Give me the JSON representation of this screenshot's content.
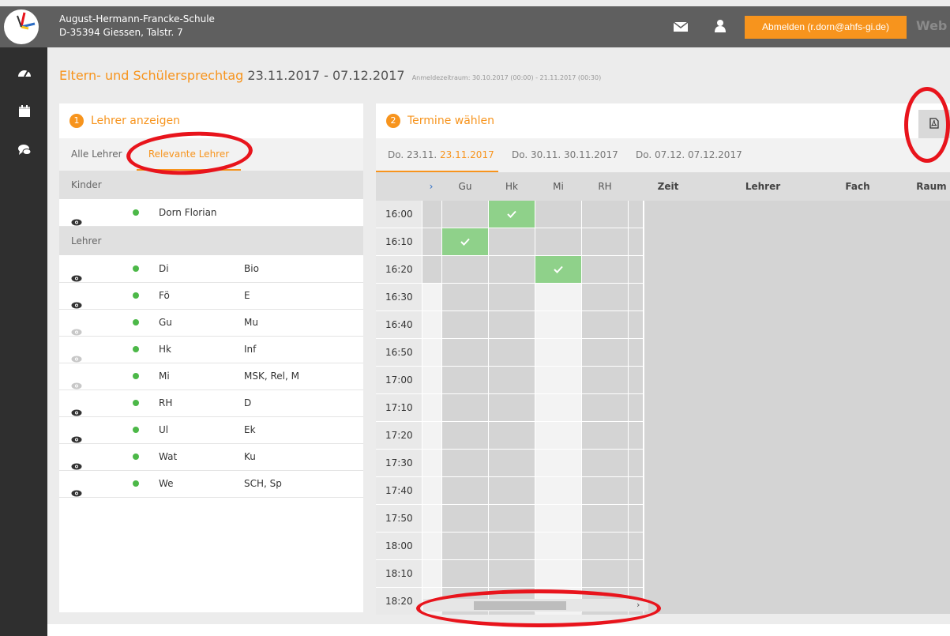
{
  "header": {
    "school_name": "August-Hermann-Francke-Schule",
    "school_address": "D-35394 Giessen, Talstr. 7",
    "logout_label": "Abmelden (r.dorn@ahfs-gi.de)",
    "brand_fragment": "Web",
    "icons": [
      "mail-icon",
      "user-icon"
    ],
    "accent_color": "#f7941d"
  },
  "nav": {
    "icons": [
      "dashboard-icon",
      "calendar-icon",
      "chat-icon"
    ]
  },
  "title": {
    "event": "Eltern- und Schülersprechtag",
    "dates": "23.11.2017 - 07.12.2017",
    "registration": "Anmeldezeitraum: 30.10.2017 (00:00) - 21.11.2017 (00:30)"
  },
  "left_panel": {
    "step": "1",
    "title": "Lehrer anzeigen",
    "tabs": [
      "Alle Lehrer",
      "Relevante Lehrer"
    ],
    "active_tab": "Relevante Lehrer",
    "children_section": "Kinder",
    "children": [
      {
        "name": "Dorn Florian"
      }
    ],
    "teachers_section": "Lehrer",
    "teachers": [
      {
        "name": "Di",
        "subject": "Bio",
        "visible": true
      },
      {
        "name": "Fö",
        "subject": "E",
        "visible": true
      },
      {
        "name": "Gu",
        "subject": "Mu",
        "visible": false
      },
      {
        "name": "Hk",
        "subject": "Inf",
        "visible": false
      },
      {
        "name": "Mi",
        "subject": "MSK, Rel, M",
        "visible": false
      },
      {
        "name": "RH",
        "subject": "D",
        "visible": true
      },
      {
        "name": "Ul",
        "subject": "Ek",
        "visible": true
      },
      {
        "name": "Wat",
        "subject": "Ku",
        "visible": true
      },
      {
        "name": "We",
        "subject": "SCH, Sp",
        "visible": true
      }
    ]
  },
  "right_panel": {
    "step": "2",
    "title": "Termine wählen",
    "pdf_icon": "pdf-icon",
    "date_tabs": [
      {
        "day": "Do. 23.11.",
        "date": "23.11.2017",
        "active": true
      },
      {
        "day": "Do. 30.11.",
        "date": "30.11.2017",
        "active": false
      },
      {
        "day": "Do. 07.12.",
        "date": "07.12.2017",
        "active": false
      }
    ],
    "grid_headers": {
      "marker": "›",
      "teachers": [
        "Gu",
        "Hk",
        "Mi",
        "RH"
      ],
      "detail_columns": [
        "Zeit",
        "Lehrer",
        "Fach",
        "Raum"
      ]
    },
    "times": [
      "16:00",
      "16:10",
      "16:20",
      "16:30",
      "16:40",
      "16:50",
      "17:00",
      "17:10",
      "17:20",
      "17:30",
      "17:40",
      "17:50",
      "18:00",
      "18:10",
      "18:20"
    ],
    "booked": [
      {
        "time": "16:00",
        "teacher": "Hk"
      },
      {
        "time": "16:10",
        "teacher": "Gu"
      },
      {
        "time": "16:20",
        "teacher": "Mi"
      }
    ],
    "scroll_arrow": "›"
  }
}
